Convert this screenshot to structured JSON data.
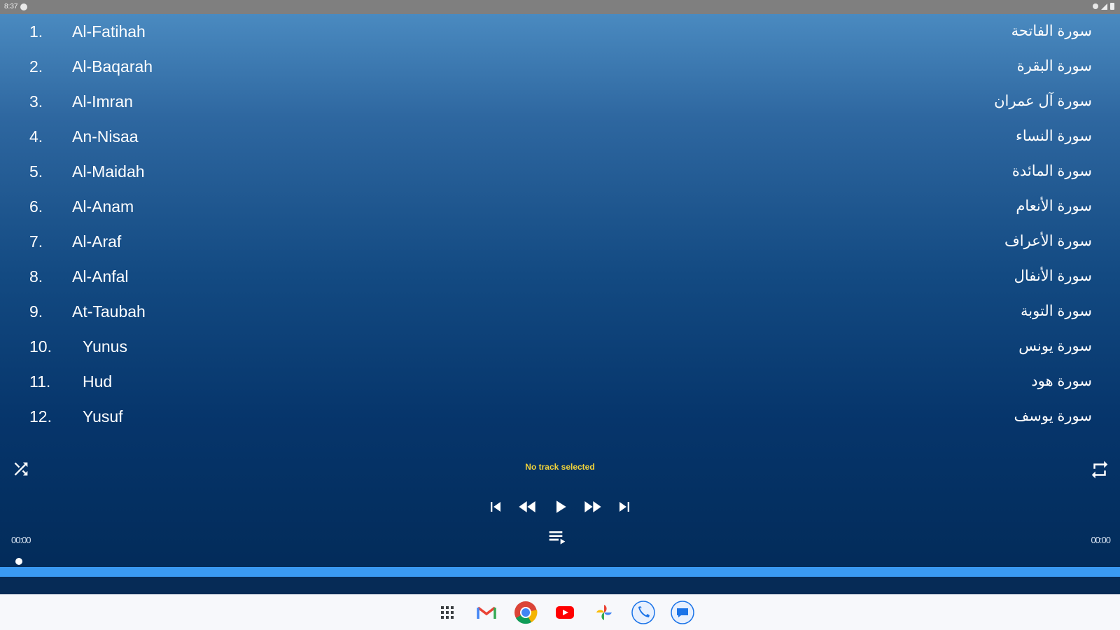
{
  "status_bar": {
    "time": "8:37"
  },
  "tracks": [
    {
      "num": "1.",
      "en": "Al-Fatihah",
      "ar": "سورة الفاتحة"
    },
    {
      "num": "2.",
      "en": "Al-Baqarah",
      "ar": "سورة البقرة"
    },
    {
      "num": "3.",
      "en": "Al-Imran",
      "ar": "سورة آل عمران"
    },
    {
      "num": "4.",
      "en": "An-Nisaa",
      "ar": "سورة النساء"
    },
    {
      "num": "5.",
      "en": "Al-Maidah",
      "ar": "سورة المائدة"
    },
    {
      "num": "6.",
      "en": "Al-Anam",
      "ar": "سورة الأنعام"
    },
    {
      "num": "7.",
      "en": "Al-Araf",
      "ar": "سورة الأعراف"
    },
    {
      "num": "8.",
      "en": "Al-Anfal",
      "ar": "سورة الأنفال"
    },
    {
      "num": "9.",
      "en": "At-Taubah",
      "ar": "سورة التوبة"
    },
    {
      "num": "10.",
      "en": "Yunus",
      "ar": "سورة يونس"
    },
    {
      "num": "11.",
      "en": "Hud",
      "ar": "سورة هود"
    },
    {
      "num": "12.",
      "en": "Yusuf",
      "ar": "سورة يوسف"
    }
  ],
  "player": {
    "now_playing": "No track selected",
    "time_elapsed": "00:00",
    "time_total": "00:00"
  },
  "colors": {
    "now_playing": "#f2d33a",
    "progress": "#3a9af2",
    "status_bar": "#7f7f7f"
  },
  "icons": {
    "shuffle": "shuffle-icon",
    "repeat": "repeat-icon",
    "skip_previous": "skip-previous-icon",
    "rewind": "rewind-icon",
    "play": "play-icon",
    "fast_forward": "fast-forward-icon",
    "skip_next": "skip-next-icon",
    "queue": "queue-music-icon"
  },
  "dock": [
    "apps-grid-icon",
    "gmail-icon",
    "chrome-icon",
    "youtube-icon",
    "photos-icon",
    "phone-icon",
    "messages-icon"
  ]
}
